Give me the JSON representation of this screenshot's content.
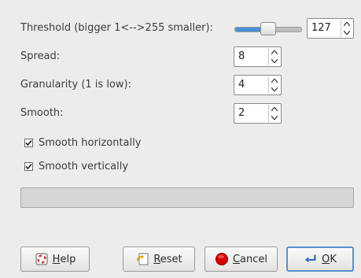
{
  "threshold": {
    "label": "Threshold (bigger 1<-->255 smaller):",
    "value": "127",
    "slider_fraction": 0.498
  },
  "spread": {
    "label": "Spread:",
    "value": "8"
  },
  "granularity": {
    "label": "Granularity (1 is low):",
    "value": "4"
  },
  "smooth": {
    "label": "Smooth:",
    "value": "2"
  },
  "smooth_horizontally": {
    "label": "Smooth horizontally",
    "checked": true
  },
  "smooth_vertically": {
    "label": "Smooth vertically",
    "checked": true
  },
  "buttons": {
    "help": {
      "mnemonic": "H",
      "rest": "elp"
    },
    "reset": {
      "mnemonic": "R",
      "rest": "eset"
    },
    "cancel": {
      "mnemonic": "C",
      "rest": "ancel"
    },
    "ok": {
      "mnemonic": "O",
      "rest": "K"
    }
  },
  "colors": {
    "accent": "#4a90d9",
    "cancel_red": "#d40000"
  }
}
